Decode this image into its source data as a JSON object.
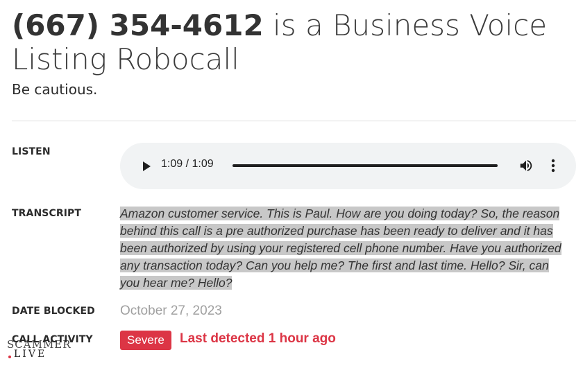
{
  "header": {
    "phone": "(667) 354-4612",
    "title_rest": " is a Business Voice Listing Robocall",
    "subtitle": "Be cautious."
  },
  "listen": {
    "label": "LISTEN",
    "time": "1:09 / 1:09",
    "progress": 1.0
  },
  "transcript": {
    "label": "TRANSCRIPT",
    "text": "Amazon customer service. This is Paul. How are you doing today? So, the reason behind this call is a pre authorized purchase has been ready to deliver and it has been authorized by using your registered cell phone number. Have you authorized any transaction today? Can you help me? The first and last time. Hello? Sir, can you hear me? Hello?"
  },
  "date_blocked": {
    "label": "DATE BLOCKED",
    "value": "October 27, 2023"
  },
  "call_activity": {
    "label": "CALL ACTIVITY",
    "severity": "Severe",
    "last_detected": "Last detected 1 hour ago"
  },
  "watermark": {
    "line1": "SCAMMER",
    "line2": "LIVE"
  },
  "colors": {
    "accent": "#dc3545",
    "player_bg": "#f1f3f4",
    "highlight": "#c8c8c8"
  },
  "icons": {
    "play": "play-icon",
    "volume": "volume-icon",
    "more": "more-vertical-icon"
  }
}
